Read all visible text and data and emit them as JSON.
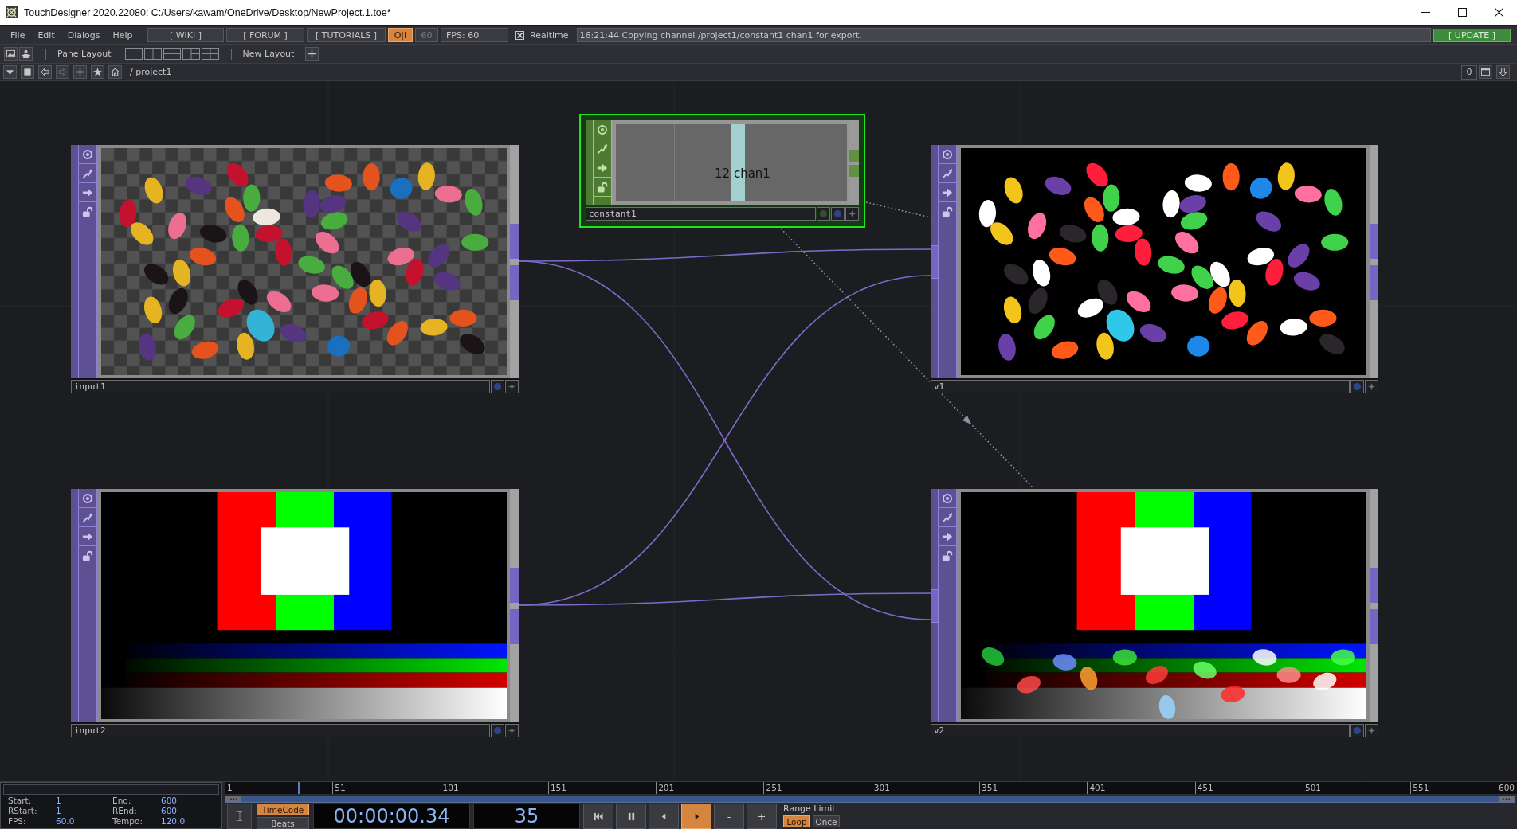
{
  "window": {
    "title": "TouchDesigner 2020.22080: C:/Users/kawam/OneDrive/Desktop/NewProject.1.toe*"
  },
  "menu_bar": {
    "menus": [
      "File",
      "Edit",
      "Dialogs",
      "Help"
    ],
    "links": [
      "[ WIKI ]",
      "[ FORUM ]",
      "[ TUTORIALS ]"
    ],
    "perform_toggle": {
      "label": "O|I",
      "on": true
    },
    "fps_limit": {
      "value": "60",
      "disabled": true
    },
    "fps_reading": "FPS: 60",
    "realtime": {
      "label": "Realtime",
      "checked": true
    },
    "status": "16:21:44 Copying channel /project1/constant1 chan1 for export.",
    "update_button": "[ UPDATE ]"
  },
  "pane_bar": {
    "pane_layout_label": "Pane Layout",
    "new_layout_label": "New Layout"
  },
  "path_bar": {
    "forward_disabled": true,
    "path": "/ project1",
    "counter": "0"
  },
  "network": {
    "nodes": [
      {
        "name": "input1",
        "kind": "top",
        "selected": false
      },
      {
        "name": "constant1",
        "kind": "chop",
        "selected": true,
        "readout": "12 chan1"
      },
      {
        "name": "v1",
        "kind": "top",
        "selected": false
      },
      {
        "name": "input2",
        "kind": "top",
        "selected": false
      },
      {
        "name": "v2",
        "kind": "top",
        "selected": false
      }
    ]
  },
  "timeline": {
    "range_settings": [
      {
        "label": "Start:",
        "value": "1"
      },
      {
        "label": "End:",
        "value": "600"
      },
      {
        "label": "RStart:",
        "value": "1"
      },
      {
        "label": "REnd:",
        "value": "600"
      },
      {
        "label": "FPS:",
        "value": "60.0"
      },
      {
        "label": "Tempo:",
        "value": "120.0"
      }
    ],
    "ruler_labels": [
      "1",
      "51",
      "101",
      "151",
      "201",
      "251",
      "301",
      "351",
      "401",
      "451",
      "501",
      "551",
      "600"
    ],
    "playhead": {
      "level": 0.057
    },
    "time_modes": [
      {
        "label": "TimeCode",
        "selected": true
      },
      {
        "label": "Beats",
        "selected": false
      }
    ],
    "timecode": "00:00:00.34",
    "frame": "35",
    "transport": [
      {
        "kind": "start",
        "selected": false
      },
      {
        "kind": "pause",
        "selected": false
      },
      {
        "kind": "reverse",
        "selected": false
      },
      {
        "kind": "play",
        "selected": true
      }
    ],
    "speed_buttons": [
      "-",
      "+"
    ],
    "range_limit": {
      "label": "Range Limit",
      "options": [
        {
          "label": "Loop",
          "selected": true
        },
        {
          "label": "Once",
          "selected": false
        }
      ]
    }
  }
}
